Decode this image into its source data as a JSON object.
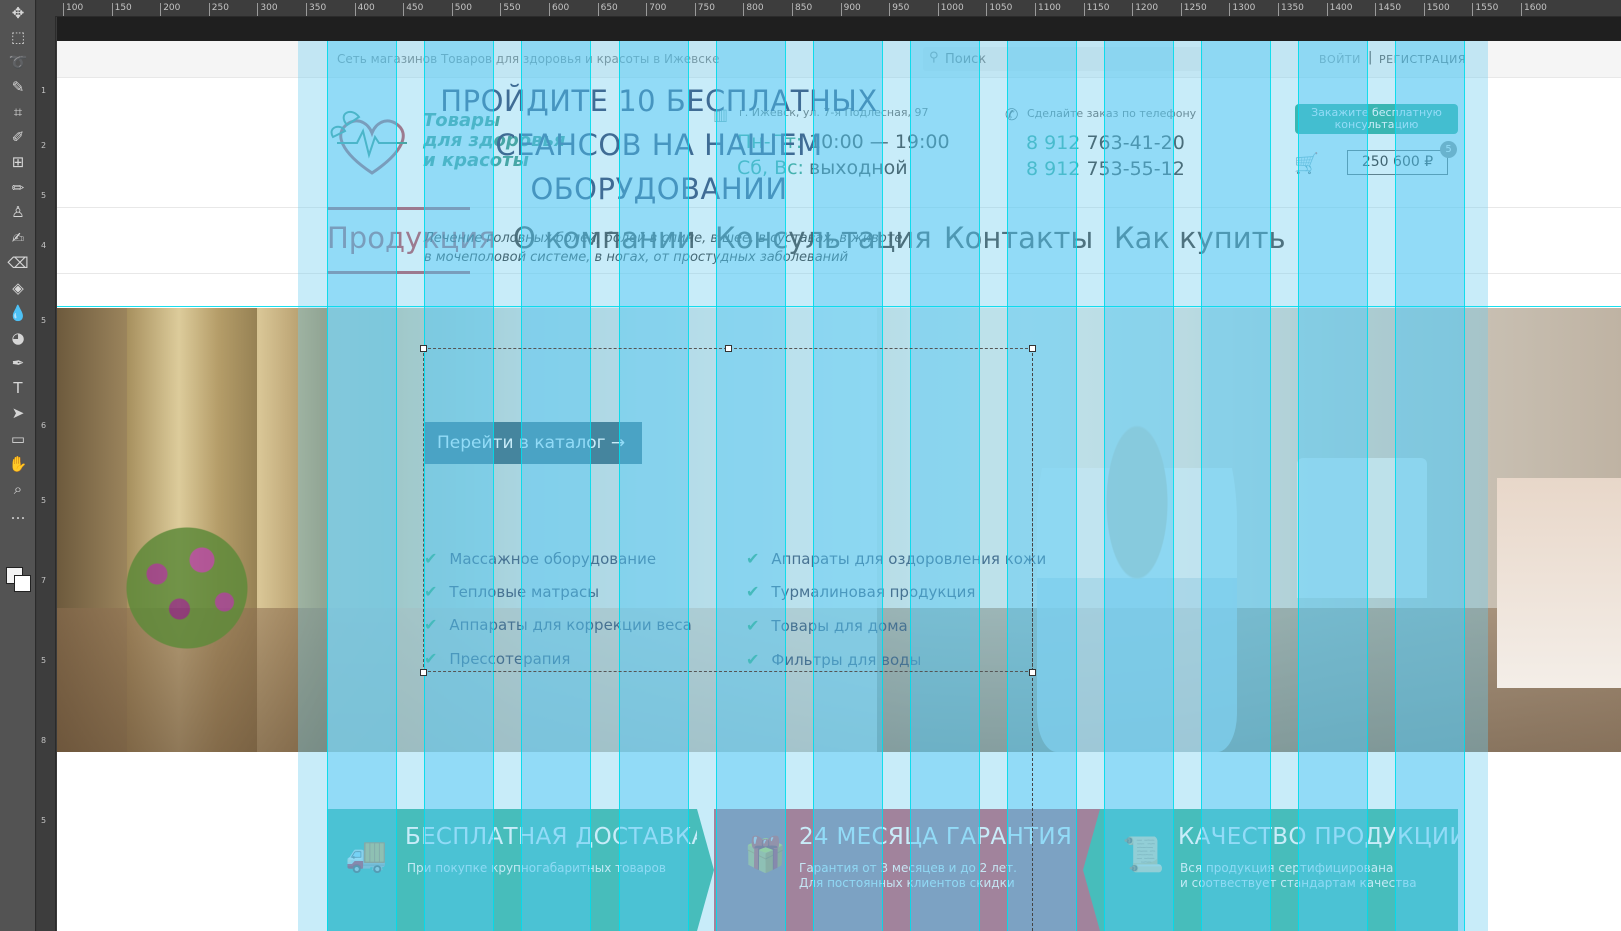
{
  "ruler": {
    "h_ticks": [
      "100",
      "150",
      "200",
      "250",
      "300",
      "350",
      "400",
      "450",
      "500",
      "550",
      "600",
      "650",
      "700",
      "750",
      "800",
      "850",
      "900",
      "950",
      "1000",
      "1050",
      "1100",
      "1150",
      "1200",
      "1250",
      "1300",
      "1350",
      "1400",
      "1450",
      "1500",
      "1550",
      "1600"
    ],
    "v_ticks": [
      "1",
      "2",
      "5",
      "4",
      "5",
      "6",
      "5",
      "7",
      "5",
      "8",
      "5"
    ]
  },
  "toolbar": {
    "tools": [
      "move-icon",
      "marquee-icon",
      "lasso-icon",
      "quick-select-icon",
      "crop-icon",
      "eyedropper-icon",
      "frame-icon",
      "brush-icon",
      "stamp-icon",
      "history-brush-icon",
      "eraser-icon",
      "bucket-icon",
      "blur-icon",
      "dodge-icon",
      "pen-icon",
      "type-icon",
      "path-select-icon",
      "rectangle-icon",
      "hand-icon",
      "zoom-icon",
      "more-icon"
    ],
    "glyphs": [
      "✥",
      "⬚",
      "➰",
      "✎",
      "⌗",
      "✐",
      "⊞",
      "✏",
      "♙",
      "✍",
      "⌫",
      "◈",
      "💧",
      "◕",
      "✒",
      "T",
      "➤",
      "▭",
      "✋",
      "⌕",
      "…"
    ]
  },
  "site": {
    "tagline": "Сеть магазинов Товаров для здоровья и красоты в Ижевске",
    "search": {
      "placeholder": "Поиск",
      "icon": "search-icon"
    },
    "auth": {
      "login": "ВОЙТИ",
      "separator": "|",
      "register": "РЕГИСТРАЦИЯ"
    },
    "logo": {
      "line1": "Товары",
      "line2": "для здоровья",
      "line3": "и красоты"
    },
    "address": "г. Ижевск, ул. 7-я Подлесная, 97",
    "hours": [
      {
        "days": "Пн-Пт:",
        "time": "10:00 — 19:00"
      },
      {
        "days": "Сб, Вс:",
        "time": "выходной"
      }
    ],
    "phone_caption": "Сделайте заказ по телефону",
    "phones": [
      {
        "code": "8 912",
        "number": "763-41-20"
      },
      {
        "code": "8 912",
        "number": "753-55-12"
      }
    ],
    "consult_button": "Закажите бесплатную консультацию",
    "cart": {
      "total": "250 600 ₽",
      "count": "5"
    },
    "nav": [
      "Продукция",
      "О компании",
      "Консультация",
      "Контакты",
      "Как купить"
    ],
    "hero": {
      "title": [
        "ПРОЙДИТЕ 10 БЕСПЛАТНЫХ",
        "СЕАНСОВ НА НАШЕМ",
        "ОБОРУДОВАНИИ"
      ],
      "subtitle_1": "Лечение головных болей, болей в спине, в шее, в суставах, в животе,",
      "subtitle_2": "в мочеполовой системе, в ногах, от простудных заболеваний",
      "features_left": [
        "Массажное оборудование",
        "Тепловые матрасы",
        "Аппараты для коррекции веса",
        "Прессотерапия"
      ],
      "features_right": [
        "Аппараты для оздоровления кожи",
        "Турмалиновая продукция",
        "Товары для дома",
        "Фильтры для воды"
      ],
      "cta": "Перейти в каталог →"
    },
    "benefits": [
      {
        "title": "БЕСПЛАТНАЯ ДОСТАВКА",
        "line1": "При покупке крупногабаритных товаров",
        "line2": ""
      },
      {
        "title": "24 МЕСЯЦА ГАРАНТИЯ",
        "line1": "Гарантия от 3 месяцев и до 2 лет.",
        "line2": "Для постоянных клиентов скидки"
      },
      {
        "title": "КАЧЕСТВО ПРОДУКЦИИ",
        "line1": "Вся продукция сертифицирована",
        "line2": "и соотвествует стандартам качества"
      }
    ]
  },
  "colors": {
    "accent_green": "#2aa087",
    "accent_red": "#b94754",
    "benefit_green": "#30b39b",
    "benefit_red": "#c0566a",
    "overlay_cyan": "#50c8f5"
  }
}
